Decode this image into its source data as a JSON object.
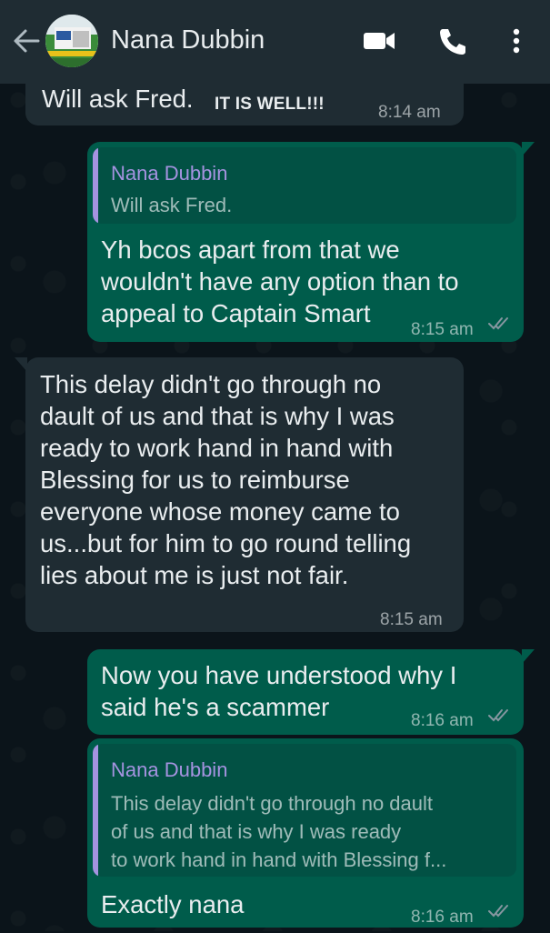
{
  "header": {
    "contact_name": "Nana Dubbin"
  },
  "icons": {
    "back": "arrow-left-icon",
    "video": "video-camera-icon",
    "call": "phone-icon",
    "menu": "more-vert-icon"
  },
  "colors": {
    "header_bg": "#1f2c33",
    "incoming_bubble": "#1f2c33",
    "outgoing_bubble": "#005c4b",
    "quote_name": "#a593e0",
    "read_ticks": "#8696a0"
  },
  "messages": [
    {
      "direction": "in",
      "text": "Will ask Fred.",
      "extra": "IT IS WELL!!!",
      "time": "8:14 am"
    },
    {
      "direction": "out",
      "quote": {
        "author": "Nana Dubbin",
        "lines": [
          "Will ask Fred."
        ]
      },
      "lines": [
        "Yh bcos apart from that we",
        "wouldn't have any option than to",
        "appeal to Captain Smart"
      ],
      "time": "8:15 am"
    },
    {
      "direction": "in",
      "lines": [
        "This delay didn't go through no",
        "dault of us and that is why I was",
        "ready to work hand in hand with",
        "Blessing for us to reimburse",
        "everyone whose money came to",
        "us...but for him to go round telling",
        "lies about me is just not fair."
      ],
      "time": "8:15 am"
    },
    {
      "direction": "out",
      "lines": [
        "Now you have understood why I",
        "said he's a scammer"
      ],
      "time": "8:16 am"
    },
    {
      "direction": "out",
      "quote": {
        "author": "Nana Dubbin",
        "lines": [
          "This delay didn't go through no dault",
          "of us and that is why I was ready",
          "to work hand in hand with Blessing f..."
        ]
      },
      "lines": [
        "Exactly nana"
      ],
      "time": "8:16 am"
    }
  ]
}
